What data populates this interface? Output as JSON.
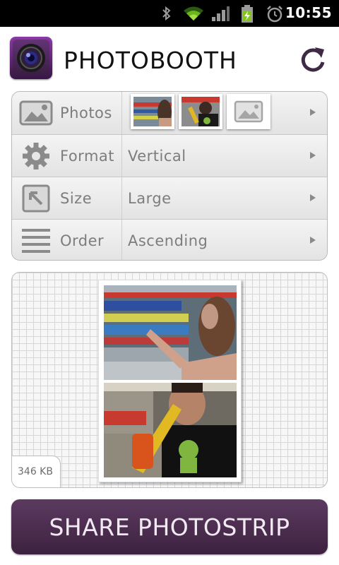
{
  "status_bar": {
    "time": "10:55",
    "icons": [
      "bluetooth-icon",
      "wifi-icon",
      "signal-icon",
      "battery-charging-icon",
      "alarm-icon"
    ]
  },
  "header": {
    "title": "PHOTOBOOTH",
    "app_icon": "camera-lens-icon",
    "refresh_icon": "refresh-icon"
  },
  "settings": {
    "rows": [
      {
        "label": "Photos",
        "icon": "image-icon",
        "value": ""
      },
      {
        "label": "Format",
        "icon": "gear-icon",
        "value": "Vertical"
      },
      {
        "label": "Size",
        "icon": "resize-icon",
        "value": "Large"
      },
      {
        "label": "Order",
        "icon": "list-icon",
        "value": "Ascending"
      }
    ]
  },
  "preview": {
    "file_size": "346 KB"
  },
  "share_button": {
    "label": "SHARE PHOTOSTRIP"
  },
  "colors": {
    "accent": "#4d2c51",
    "status_bar": "#000000",
    "label_text": "#7d7d7d"
  }
}
